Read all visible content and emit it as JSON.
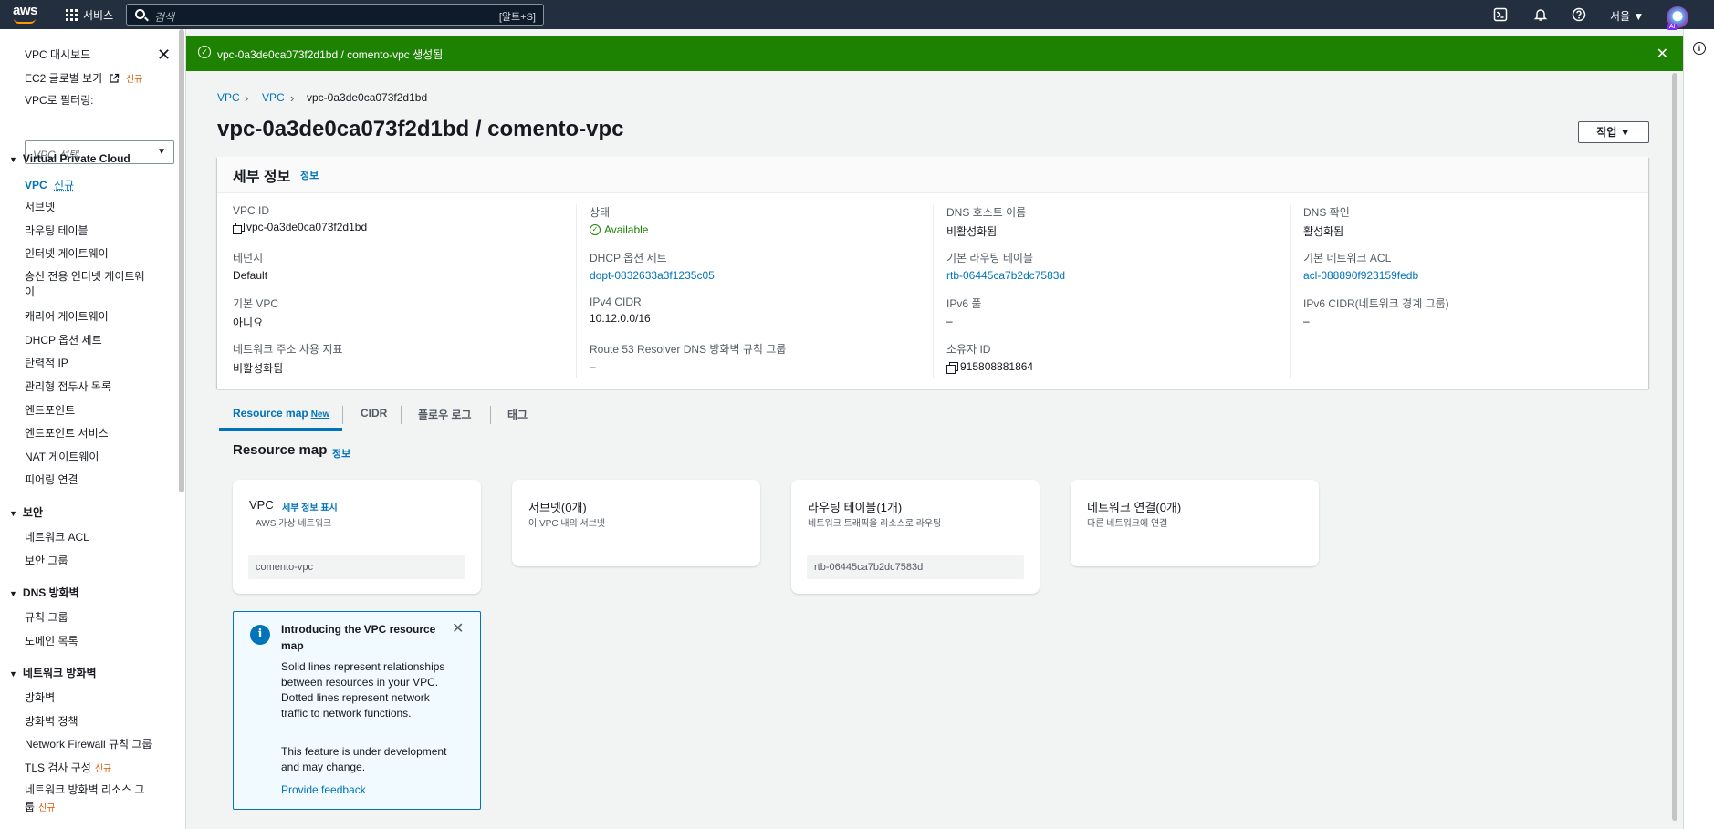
{
  "topnav": {
    "logo": "aws",
    "services_label": "서비스",
    "search_placeholder": "검색",
    "search_shortcut": "[알트+S]",
    "region": "서울 ▼",
    "ai_badge": "AI"
  },
  "sidebar": {
    "items_top": [
      {
        "label": "VPC 대시보드"
      },
      {
        "label": "EC2 글로벌 보기",
        "new": "신규"
      },
      {
        "label": "VPC로 필터링:"
      }
    ],
    "vpc_select_placeholder": "VPC 선택",
    "sections": [
      {
        "title": "Virtual Private Cloud",
        "items": [
          "VPC",
          "서브넷",
          "라우팅 테이블",
          "인터넷 게이트웨이",
          "송신 전용 인터넷 게이트웨이",
          "캐리어 게이트웨이",
          "DHCP 옵션 세트",
          "탄력적 IP",
          "관리형 접두사 목록",
          "엔드포인트",
          "엔드포인트 서비스",
          "NAT 게이트웨이",
          "피어링 연결"
        ]
      },
      {
        "title": "보안",
        "items": [
          "네트워크 ACL",
          "보안 그룹"
        ]
      },
      {
        "title": "DNS 방화벽",
        "items": [
          "규칙 그룹",
          "도메인 목록"
        ]
      },
      {
        "title": "네트워크 방화벽",
        "items": [
          "방화벽",
          "방화벽 정책",
          "Network Firewall 규칙 그룹",
          "TLS 검사 구성",
          "네트워크 방화벽 리소스 그룹"
        ]
      }
    ],
    "vpc_new": "신규",
    "egress_line1": "송신 전용 인터넷 게이트웨",
    "egress_line2": "이",
    "tls_new": "신규",
    "nfrg_line1": "네트워크 방화벽 리소스 그",
    "nfrg_line2": "룹",
    "nfrg_new": "신규"
  },
  "flash": {
    "message": "vpc-0a3de0ca073f2d1bd / comento-vpc 생성됨",
    "color": "#1d8102"
  },
  "breadcrumb": [
    "VPC",
    "VPC",
    "vpc-0a3de0ca073f2d1bd"
  ],
  "page": {
    "title": "vpc-0a3de0ca073f2d1bd / comento-vpc",
    "actions_label": "작업 ▼"
  },
  "details": {
    "title": "세부 정보",
    "info": "정보",
    "vpc_id": {
      "k": "VPC ID",
      "v": "vpc-0a3de0ca073f2d1bd"
    },
    "state": {
      "k": "상태",
      "v": "Available"
    },
    "dns_hostnames": {
      "k": "DNS 호스트 이름",
      "v": "비활성화됨"
    },
    "dns_resolution": {
      "k": "DNS 확인",
      "v": "활성화됨"
    },
    "tenancy": {
      "k": "테넌시",
      "v": "Default"
    },
    "dhcp": {
      "k": "DHCP 옵션 세트",
      "v": "dopt-0832633a3f1235c05"
    },
    "main_rtb": {
      "k": "기본 라우팅 테이블",
      "v": "rtb-06445ca7b2dc7583d"
    },
    "main_acl": {
      "k": "기본 네트워크 ACL",
      "v": "acl-088890f923159fedb"
    },
    "default_vpc": {
      "k": "기본 VPC",
      "v": "아니요"
    },
    "ipv4": {
      "k": "IPv4 CIDR",
      "v": "10.12.0.0/16"
    },
    "ipv6_pool": {
      "k": "IPv6 풀",
      "v": "–"
    },
    "ipv6_cidr": {
      "k": "IPv6 CIDR(네트워크 경계 그룹)",
      "v": "–"
    },
    "net_usage": {
      "k": "네트워크 주소 사용 지표",
      "v": "비활성화됨"
    },
    "r53": {
      "k": "Route 53 Resolver DNS 방화벽 규칙 그룹",
      "v": "–"
    },
    "owner": {
      "k": "소유자 ID",
      "v": "915808881864"
    }
  },
  "tabs": [
    {
      "label": "Resource map",
      "badge": "New"
    },
    {
      "label": "CIDR"
    },
    {
      "label": "플로우 로그"
    },
    {
      "label": "태그"
    }
  ],
  "resource_map": {
    "title": "Resource map",
    "info": "정보",
    "vpc_card": {
      "title": "VPC",
      "details_link": "세부 정보 표시",
      "subtitle": "AWS 가상 네트워크",
      "chip": "comento-vpc"
    },
    "subnet_card": {
      "title": "서브넷(0개)",
      "subtitle": "이 VPC 내의 서브넷"
    },
    "rtb_card": {
      "title": "라우팅 테이블(1개)",
      "subtitle": "네트워크 트래픽을 리소스로 라우팅",
      "chip": "rtb-06445ca7b2dc7583d"
    },
    "netconn_card": {
      "title": "네트워크 연결(0개)",
      "subtitle": "다른 네트워크에 연결"
    }
  },
  "intro": {
    "heading": "Introducing the VPC resource map",
    "body1": "Solid lines represent relationships between resources in your VPC. Dotted lines represent network traffic to network functions.",
    "body2": "This feature is under development and may change.",
    "feedback": "Provide feedback"
  }
}
